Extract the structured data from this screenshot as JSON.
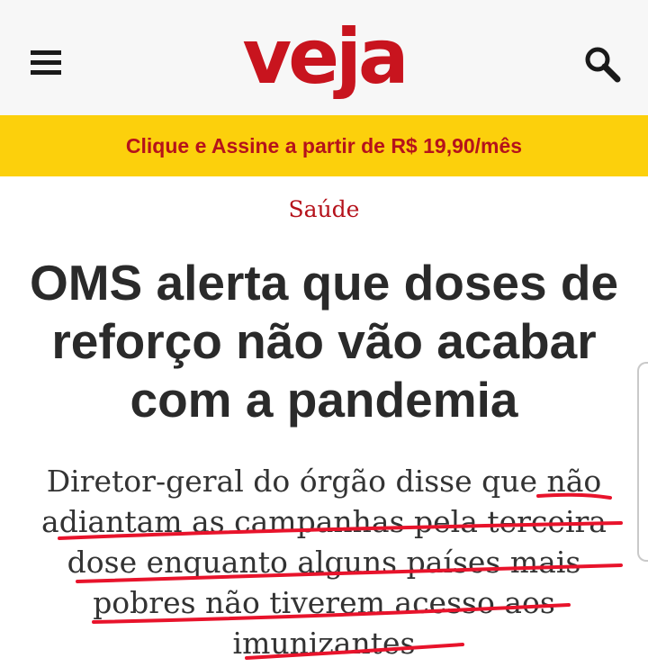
{
  "header": {
    "logo_text": "veja",
    "menu_icon": "hamburger-menu-icon",
    "search_icon": "search-icon",
    "background_color": "#f7f7f7",
    "logo_color": "#c8141e"
  },
  "promo_banner": {
    "text": "Clique e Assine a partir de R$ 19,90/mês",
    "background_color": "#fcd00c",
    "text_color": "#b5121b"
  },
  "article": {
    "category": "Saúde",
    "headline": "OMS alerta que doses de reforço não vão acabar com a pandemia",
    "subtitle": "Diretor-geral do órgão disse que não adiantam as campanhas pela terceira dose enquanto alguns países mais pobres não tiverem acesso aos imunizantes"
  },
  "annotation": {
    "type": "hand-drawn-underline",
    "color": "#e8132b"
  }
}
